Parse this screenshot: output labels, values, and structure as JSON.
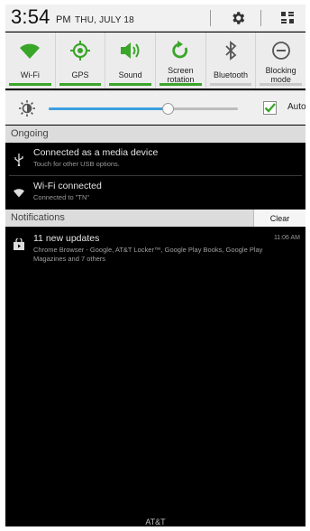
{
  "status": {
    "time": "3:54",
    "ampm": "PM",
    "date": "THU, JULY 18",
    "settings_icon": "gear-icon",
    "menu_icon": "grid-icon"
  },
  "toggles": [
    {
      "label": "Wi-Fi",
      "icon": "wifi-icon",
      "on": true
    },
    {
      "label": "GPS",
      "icon": "gps-icon",
      "on": true
    },
    {
      "label": "Sound",
      "icon": "sound-icon",
      "on": true
    },
    {
      "label": "Screen\nrotation",
      "icon": "rotation-icon",
      "on": true
    },
    {
      "label": "Bluetooth",
      "icon": "bluetooth-icon",
      "on": false
    },
    {
      "label": "Blocking\nmode",
      "icon": "blocking-icon",
      "on": false
    }
  ],
  "brightness": {
    "level": 0.63,
    "auto_label": "Auto",
    "auto_checked": true
  },
  "ongoing": {
    "title": "Ongoing",
    "items": [
      {
        "title": "Connected as a media device",
        "subtitle": "Touch for other USB options."
      },
      {
        "title": "Wi-Fi connected",
        "subtitle": "Connected to \"TN\""
      }
    ]
  },
  "notifications": {
    "title": "Notifications",
    "clear_label": "Clear",
    "items": [
      {
        "title": "11 new updates",
        "time": "11:06 AM",
        "body": "Chrome Browser - Google, AT&T Locker™, Google Play Books, Google Play Magazines and 7 others"
      }
    ]
  },
  "carrier": "AT&T",
  "colors": {
    "toggle_on": "#3aa629",
    "slider": "#3b9fe0",
    "checkbox": "#3aa629"
  }
}
